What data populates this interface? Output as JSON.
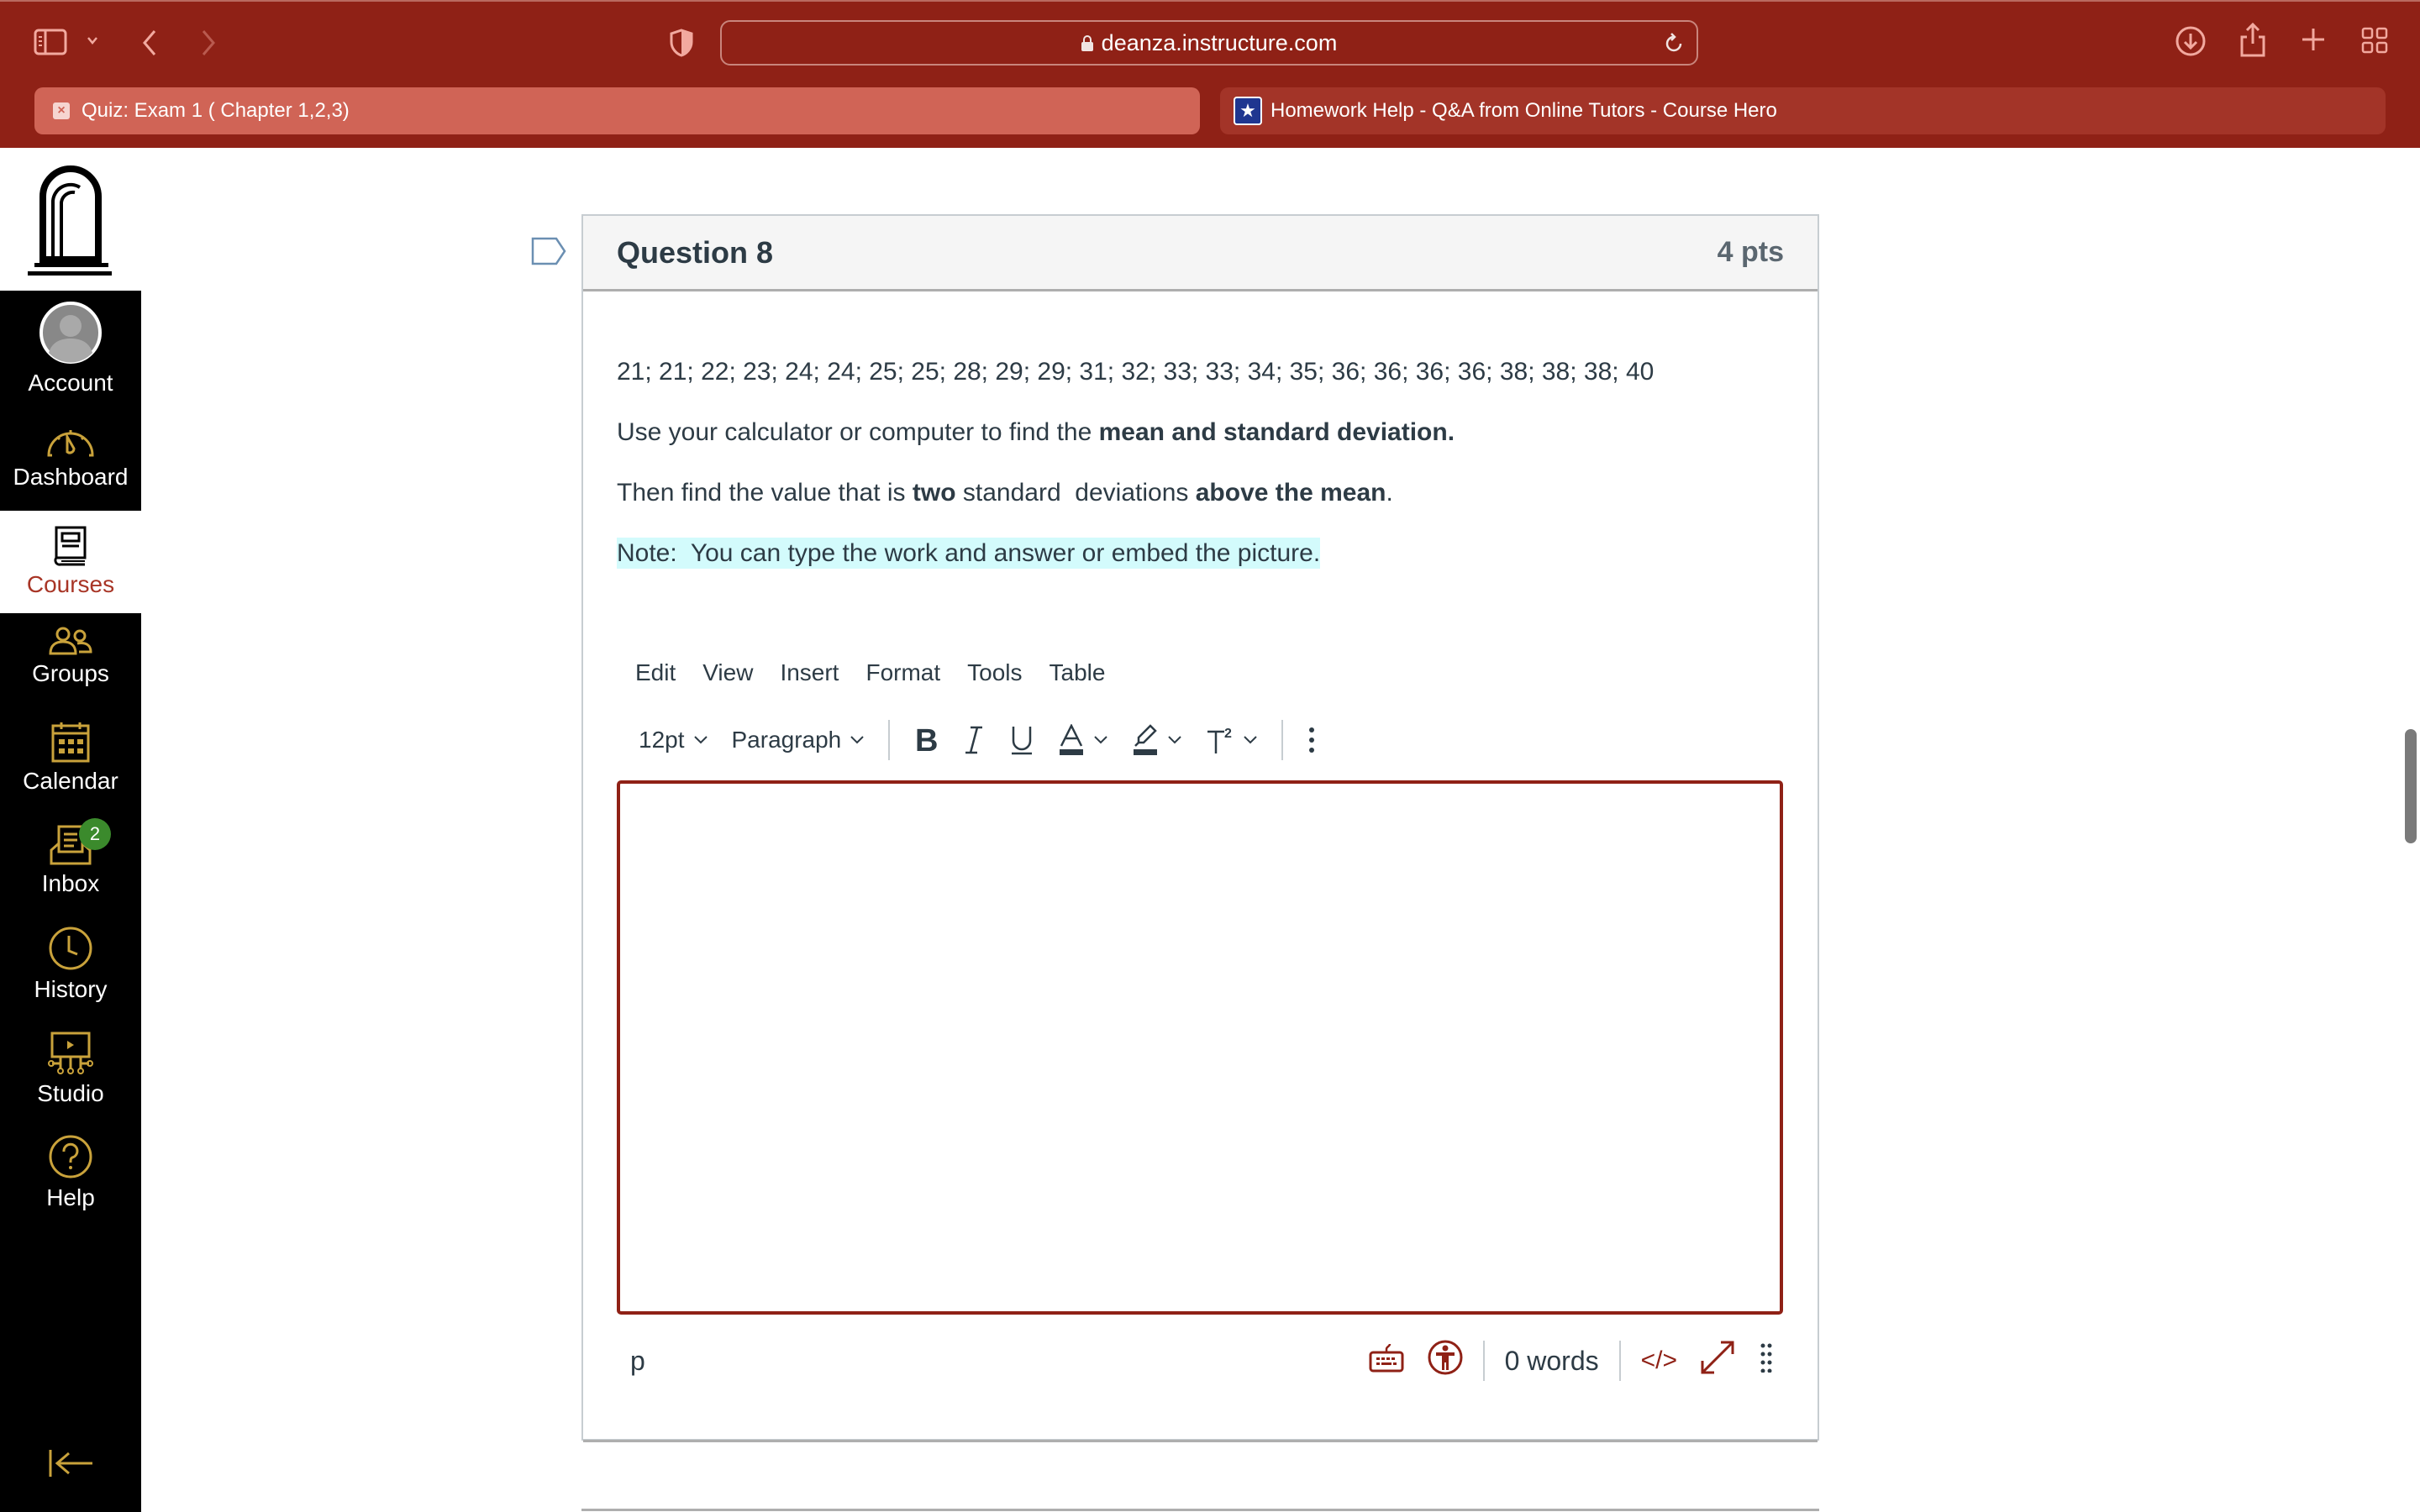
{
  "browser": {
    "url": "deanza.instructure.com",
    "tabs": [
      {
        "title": "Quiz: Exam 1 ( Chapter 1,2,3)",
        "active": true
      },
      {
        "title": "Homework Help - Q&A from Online Tutors - Course Hero",
        "active": false
      }
    ],
    "close_glyph": "×",
    "favicon_glyph": "★"
  },
  "sidebar": {
    "items": [
      {
        "label": "Account",
        "icon": "avatar-icon"
      },
      {
        "label": "Dashboard",
        "icon": "dashboard-icon"
      },
      {
        "label": "Courses",
        "icon": "courses-icon",
        "active": true
      },
      {
        "label": "Groups",
        "icon": "groups-icon"
      },
      {
        "label": "Calendar",
        "icon": "calendar-icon"
      },
      {
        "label": "Inbox",
        "icon": "inbox-icon",
        "badge": "2"
      },
      {
        "label": "History",
        "icon": "history-icon"
      },
      {
        "label": "Studio",
        "icon": "studio-icon"
      },
      {
        "label": "Help",
        "icon": "help-icon"
      }
    ]
  },
  "question": {
    "title": "Question 8",
    "points": "4 pts",
    "data_line": "21; 21; 22; 23; 24; 24; 25; 25; 28; 29; 29; 31; 32; 33; 33; 34; 35; 36; 36; 36; 36; 38; 38; 38; 40",
    "line2_plain": "Use your calculator or computer to find the ",
    "line2_bold": "mean and standard deviation.",
    "line3_a": "Then find the value that is ",
    "line3_b": "two",
    "line3_c": " standard  deviations ",
    "line3_d": "above the mean",
    "line3_e": ".",
    "note": "Note:  You can type the work and answer or embed the picture."
  },
  "editor": {
    "menu": [
      "Edit",
      "View",
      "Insert",
      "Format",
      "Tools",
      "Table"
    ],
    "font_size": "12pt",
    "block_format": "Paragraph",
    "content": "",
    "path": "p",
    "word_count": "0 words",
    "html_toggle": "</>"
  },
  "colors": {
    "brand": "#8f2116",
    "sidebar_icon": "#c9a23b",
    "text": "#2d3b45",
    "badge": "#3b8a2c",
    "highlight": "#d3fbfc"
  }
}
